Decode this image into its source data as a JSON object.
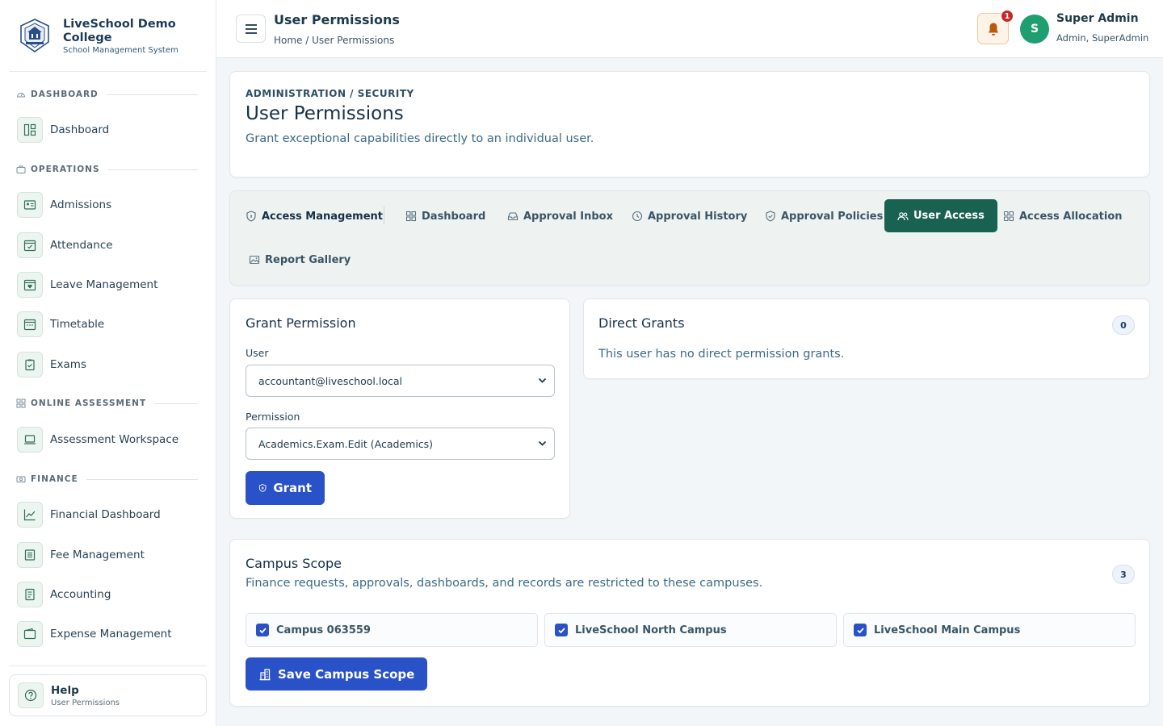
{
  "brand": {
    "name": "LiveSchool Demo College",
    "subtitle": "School Management System"
  },
  "sidebar": {
    "sections": [
      {
        "label": "DASHBOARD",
        "icon": "gauge-icon",
        "items": [
          {
            "label": "Dashboard",
            "icon": "layout-icon"
          }
        ]
      },
      {
        "label": "OPERATIONS",
        "icon": "briefcase-icon",
        "items": [
          {
            "label": "Admissions",
            "icon": "id-card-icon"
          },
          {
            "label": "Attendance",
            "icon": "calendar-check-icon"
          },
          {
            "label": "Leave Management",
            "icon": "calendar-heart-icon"
          },
          {
            "label": "Timetable",
            "icon": "calendar-grid-icon"
          },
          {
            "label": "Exams",
            "icon": "clipboard-check-icon"
          }
        ]
      },
      {
        "label": "ONLINE ASSESSMENT",
        "icon": "grid-icon",
        "items": [
          {
            "label": "Assessment Workspace",
            "icon": "laptop-icon"
          }
        ]
      },
      {
        "label": "FINANCE",
        "icon": "cash-icon",
        "items": [
          {
            "label": "Financial Dashboard",
            "icon": "chart-line-icon"
          },
          {
            "label": "Fee Management",
            "icon": "receipt-icon"
          },
          {
            "label": "Accounting",
            "icon": "ledger-icon"
          },
          {
            "label": "Expense Management",
            "icon": "wallet-icon"
          }
        ]
      }
    ],
    "help": {
      "title": "Help",
      "subtitle": "User Permissions"
    }
  },
  "topbar": {
    "title": "User Permissions",
    "breadcrumb": "Home / User Permissions",
    "notification_count": "1",
    "avatar_initial": "S",
    "user_name": "Super Admin",
    "user_role": "Admin, SuperAdmin"
  },
  "header": {
    "eyebrow": "ADMINISTRATION / SECURITY",
    "title": "User Permissions",
    "description": "Grant exceptional capabilities directly to an individual user."
  },
  "tabs": [
    {
      "label": "Access Management",
      "icon": "shield-icon",
      "active": false
    },
    {
      "label": "Dashboard",
      "icon": "grid-icon",
      "active": false
    },
    {
      "label": "Approval Inbox",
      "icon": "inbox-icon",
      "active": false
    },
    {
      "label": "Approval History",
      "icon": "clock-icon",
      "active": false
    },
    {
      "label": "Approval Policies",
      "icon": "shield-check-icon",
      "active": false
    },
    {
      "label": "User Access",
      "icon": "users-icon",
      "active": true
    },
    {
      "label": "Access Allocation",
      "icon": "grid-icon",
      "active": false
    },
    {
      "label": "Report Gallery",
      "icon": "image-icon",
      "active": false
    }
  ],
  "grant": {
    "title": "Grant Permission",
    "user_label": "User",
    "user_value": "accountant@liveschool.local",
    "permission_label": "Permission",
    "permission_value": "Academics.Exam.Edit (Academics)",
    "button": "Grant"
  },
  "direct_grants": {
    "title": "Direct Grants",
    "count": "0",
    "empty_text": "This user has no direct permission grants."
  },
  "campus_scope": {
    "title": "Campus Scope",
    "description": "Finance requests, approvals, dashboards, and records are restricted to these campuses.",
    "count": "3",
    "campuses": [
      {
        "label": "Campus 063559",
        "checked": true
      },
      {
        "label": "LiveSchool North Campus",
        "checked": true
      },
      {
        "label": "LiveSchool Main Campus",
        "checked": true
      }
    ],
    "button": "Save Campus Scope"
  },
  "colors": {
    "primary": "#2a52c8",
    "active_tab": "#196151",
    "accent_green": "#1f9e72",
    "badge_red": "#c62828"
  }
}
